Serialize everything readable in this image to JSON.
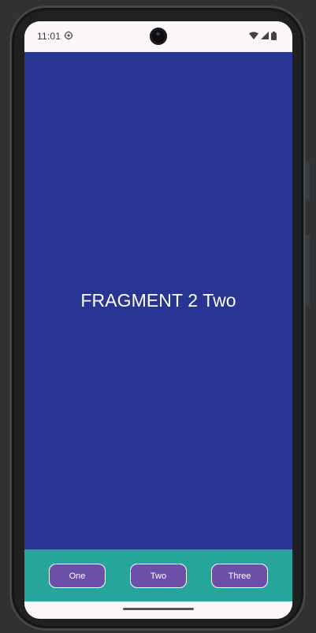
{
  "status_bar": {
    "time": "11:01",
    "left_icon": "gear-icon",
    "right_icons": [
      "wifi-icon",
      "signal-icon",
      "battery-icon"
    ]
  },
  "fragment": {
    "text": "FRAGMENT 2 Two",
    "background": "#283593"
  },
  "bottom_nav": {
    "background": "#26a69a",
    "button_color": "#6c4fa8",
    "buttons": [
      {
        "label": "One"
      },
      {
        "label": "Two"
      },
      {
        "label": "Three"
      }
    ]
  }
}
